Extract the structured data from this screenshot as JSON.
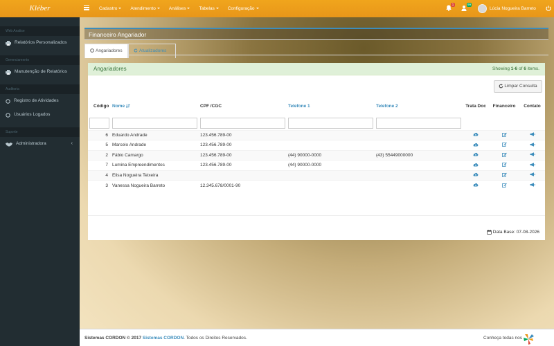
{
  "header": {
    "brand": "Kléber",
    "menu": [
      "Cadastro",
      "Atendimento",
      "Análises",
      "Tabelas",
      "Configuração"
    ],
    "notifications_count": "1",
    "users_count": "99",
    "user_name": "Lúcia Nogueira Barreto"
  },
  "sidebar": {
    "sections": [
      {
        "header": "Web Analise",
        "items": [
          "Relatórios Personalizados"
        ]
      },
      {
        "header": "Gerenciamento",
        "items": [
          "Manutenção de Relatórios"
        ]
      },
      {
        "header": "Auditoria",
        "items": [
          "Registro de Atividades",
          "Usuários Logados"
        ]
      },
      {
        "header": "Suporte",
        "items": [
          "Administradora"
        ]
      }
    ]
  },
  "panel": {
    "title": "Financeiro Angariador",
    "tabs": [
      "Angariadores",
      "Atualizadores"
    ]
  },
  "grid": {
    "title": "Angariadores",
    "summary_prefix": "Showing ",
    "summary_range": "1-6",
    "summary_mid": " of ",
    "summary_total": "6",
    "summary_suffix": " items.",
    "clear_button": "Limpar Consulta",
    "columns": {
      "codigo": "Código",
      "nome": "Nome",
      "cpf": "CPF /CGC",
      "tel1": "Telefone 1",
      "tel2": "Telefone 2",
      "trata_doc": "Trata Doc",
      "financeiro": "Financeiro",
      "contato": "Contato"
    },
    "rows": [
      {
        "codigo": "6",
        "nome": "Eduardo Andrade",
        "cpf": "123.456.789-00",
        "tel1": "",
        "tel2": ""
      },
      {
        "codigo": "5",
        "nome": "Marcelo Andrade",
        "cpf": "123.456.789-00",
        "tel1": "",
        "tel2": ""
      },
      {
        "codigo": "2",
        "nome": "Fábio Camargo",
        "cpf": "123.456.789-00",
        "tel1": "(44) 90000-0000",
        "tel2": "(43) 55449000000"
      },
      {
        "codigo": "7",
        "nome": "Lumina Empreendimentos",
        "cpf": "123.456.789-00",
        "tel1": "(44) 90000-0000",
        "tel2": ""
      },
      {
        "codigo": "4",
        "nome": "Elisa Nogueira Teixeira",
        "cpf": "",
        "tel1": "",
        "tel2": ""
      },
      {
        "codigo": "3",
        "nome": "Vanessa Nogueira Barreto",
        "cpf": "12.345.678/0001-90",
        "tel1": "",
        "tel2": ""
      }
    ],
    "db_date": "Data Base: 07-08-2026"
  },
  "footer": {
    "left_prefix": "Sistemas CORDON © 2017 ",
    "left_link": "Sistemas CORDON",
    "left_suffix": ". Todos os Direitos Reservados.",
    "right": "Conheça todas nos"
  },
  "colors": {
    "topbar": "#f0a51c",
    "sidebar": "#222d32",
    "accent": "#3c8dbc",
    "success_bg": "#dff0d8"
  },
  "icons": {
    "trata_doc": "cloud-upload-icon",
    "financeiro": "edit-icon",
    "contato": "megaphone-icon"
  }
}
